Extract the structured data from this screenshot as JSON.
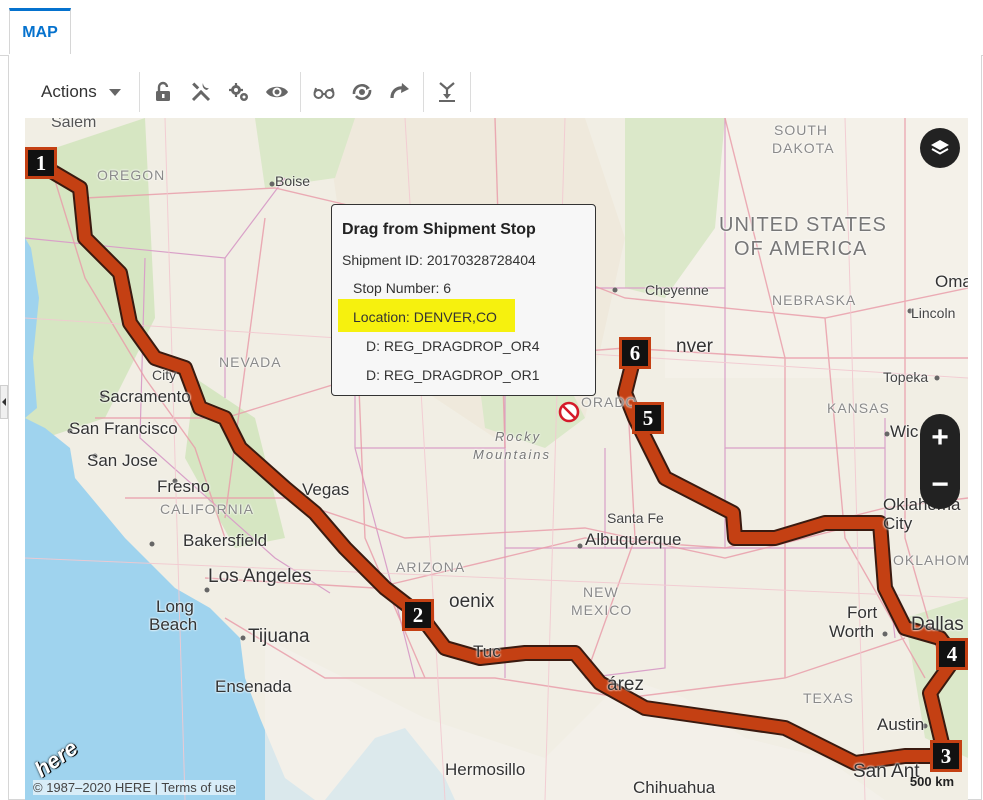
{
  "tabs": [
    {
      "label": "MAP",
      "active": true
    }
  ],
  "toolbar": {
    "actions_label": "Actions",
    "buttons": [
      "unlock-icon",
      "tools-icon",
      "gears-icon",
      "eye-icon",
      "glasses-icon",
      "sync-icon",
      "redo-icon",
      "merge-icon"
    ]
  },
  "map": {
    "labels": {
      "salem": "Salem",
      "oregon": "OREGON",
      "boise": "Boise",
      "south_dakota_1": "SOUTH",
      "south_dakota_2": "DAKOTA",
      "usa_1": "UNITED STATES",
      "usa_2": "OF AMERICA",
      "omaha": "Oma",
      "cheyenne": "Cheyenne",
      "nebraska": "NEBRASKA",
      "lincoln": "Lincoln",
      "nevada": "NEVADA",
      "city": "City",
      "sacramento": "Sacramento",
      "san_francisco": "San Francisco",
      "san_jose": "San Jose",
      "fresno": "Fresno",
      "california": "CALIFORNIA",
      "bakersfield": "Bakersfield",
      "los_angeles": "Los Angeles",
      "long_beach_1": "Long",
      "long_beach_2": "Beach",
      "tijuana": "Tijuana",
      "ensenada": "Ensenada",
      "las_vegas": "Vegas",
      "rocky_1": "Rocky",
      "rocky_2": "Mountains",
      "colorado": "ORADO",
      "denver": "nver",
      "topeka": "Topeka",
      "kansas": "KANSAS",
      "wichita": "Wic",
      "santa_fe": "Santa Fe",
      "albuquerque": "Albuquerque",
      "arizona": "ARIZONA",
      "phoenix": "oenix",
      "new_mexico_1": "NEW",
      "new_mexico_2": "MEXICO",
      "oklahoma_1": "Oklahoma",
      "oklahoma_2": "City",
      "oklahoma_state": "OKLAHOMA",
      "fort_worth_1": "Fort",
      "fort_worth_2": "Worth",
      "dallas": "Dallas",
      "tucson": "Tuc",
      "juarez": "árez",
      "texas": "TEXAS",
      "austin": "Austin",
      "hermosillo": "Hermosillo",
      "chihuahua": "Chihuahua",
      "san_antonio": "San Ant"
    },
    "stops": [
      "1",
      "2",
      "3",
      "4",
      "5",
      "6"
    ],
    "logo": "here",
    "copyright": "© 1987–2020 HERE | Terms of use",
    "scale": "500 km"
  },
  "tooltip": {
    "title": "Drag from Shipment Stop",
    "shipment_id": "Shipment ID: 20170328728404",
    "stop_number": "Stop Number: 6",
    "location": "Location: DENVER,CO",
    "d1": "D: REG_DRAGDROP_OR4",
    "d2": "D: REG_DRAGDROP_OR1"
  },
  "colors": {
    "route": "#c44013",
    "tab_accent": "#0572ce",
    "highlight": "#f6f10e",
    "ocean": "#9fd3ee"
  }
}
